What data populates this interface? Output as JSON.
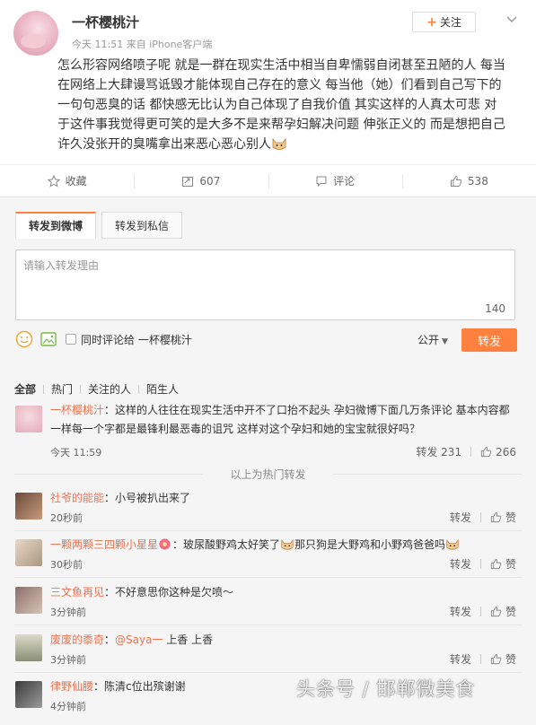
{
  "post": {
    "author": "一杯樱桃汁",
    "meta": "今天 11:51 来自 iPhone客户端",
    "follow_label": "关注",
    "text_lines": [
      "怎么形容网络喷子呢 就是一群在现实生活中相当自卑懦弱自闭甚至丑陋的人 每当",
      "在网络上大肆谩骂诋毁才能体现自己存在的意义 每当他（她）们看到自己写下的",
      "一句句恶臭的话 都快感无比认为自己体现了自我价值 其实这样的人真太可悲 对",
      "于这件事我觉得更可笑的是大多不是来帮孕妇解决问题 伸张正义的 而是想把自己",
      "许久没张开的臭嘴拿出来恶心恶心别人"
    ]
  },
  "actions": {
    "favorite": "收藏",
    "repost_count": "607",
    "comment": "评论",
    "like_count": "538"
  },
  "repost_box": {
    "tab_weibo": "转发到微博",
    "tab_private": "转发到私信",
    "placeholder": "请输入转发理由",
    "char_count": "140",
    "sync_label": "同时评论给 一杯樱桃汁",
    "visibility": "公开",
    "submit_label": "转发"
  },
  "filters": [
    "全部",
    "热门",
    "关注的人",
    "陌生人"
  ],
  "hot_repost": {
    "name": "一杯樱桃汁",
    "line1": "：这样的人往往在现实生活中开不了口抬不起头 孕妇微博下面几万条评论 基本内容都",
    "line2": "一样每一个字都是最锋利最恶毒的诅咒 这样对这个孕妇和她的宝宝就很好吗？",
    "time": "今天 11:59",
    "repost_label": "转发 231",
    "like_count": "266"
  },
  "divider": "以上为热门转发",
  "reposts": [
    {
      "name": "社爷的能能",
      "text": "：小号被扒出来了",
      "time": "20秒前",
      "repost_label": "转发",
      "like_label": "赞"
    },
    {
      "name": "一颗两颗三四颗小星星",
      "text_a": "：玻尿酸野鸡太好笑了",
      "text_b": "那只狗是大野鸡和小野鸡爸爸吗",
      "time": "30秒前",
      "repost_label": "转发",
      "like_label": "赞"
    },
    {
      "name": "三文鱼再见",
      "text": "：不好意思你这种是欠喷～",
      "time": "3分钟前",
      "repost_label": "转发",
      "like_label": "赞"
    },
    {
      "name": "废废的黍奇",
      "text_prefix": "：",
      "mention": "@Saya一",
      "text": " 上香 上香",
      "time": "3分钟前",
      "repost_label": "转发",
      "like_label": "赞"
    },
    {
      "name": "律野仙腰",
      "text": "：陈清c位出殡谢谢",
      "time": "4分钟前"
    }
  ],
  "watermark": "头条号 / 邯郸微美食",
  "colors": {
    "accent": "#ff8140",
    "link": "#eb7350",
    "panel_bg": "#f5f5f5"
  }
}
